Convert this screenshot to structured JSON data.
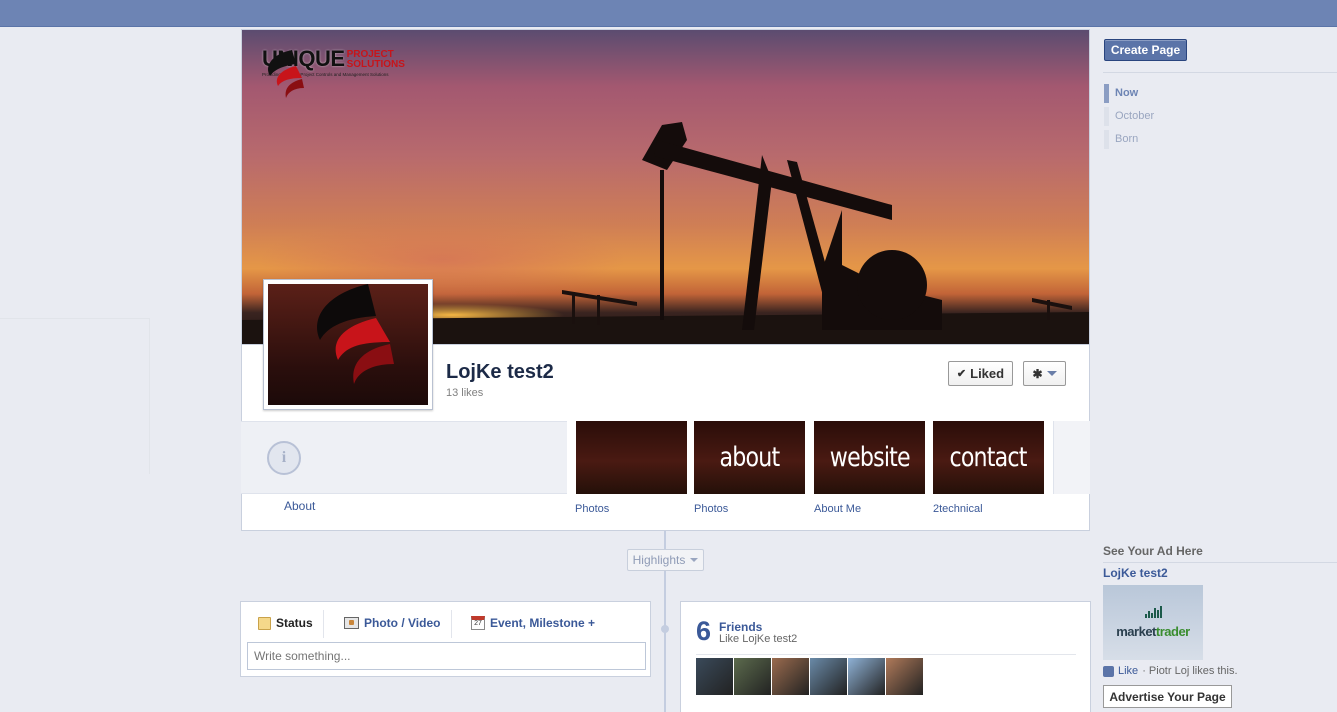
{
  "cover": {
    "brand_name": "UNIQUE",
    "brand_sub_line1": "PROJECT",
    "brand_sub_line2": "SOLUTIONS",
    "brand_tagline": "Providing Effective Project Controls and Management Solutions"
  },
  "page": {
    "name": "LojKe test2",
    "likes": "13 likes",
    "liked_label": "Liked"
  },
  "about": {
    "link": "About"
  },
  "apps": [
    {
      "tile_text": "",
      "label": "Photos"
    },
    {
      "tile_text": "about",
      "label": "Photos"
    },
    {
      "tile_text": "website",
      "label": "About Me"
    },
    {
      "tile_text": "contact",
      "label": "2technical"
    }
  ],
  "highlights": {
    "label": "Highlights"
  },
  "composer": {
    "tabs": [
      "Status",
      "Photo / Video",
      "Event, Milestone +"
    ],
    "placeholder": "Write something...",
    "event_day": "27"
  },
  "friends": {
    "count": "6",
    "title": "Friends",
    "subtitle": "Like LojKe test2",
    "thumb_colors": [
      "#3a4a5a",
      "#5c6b4d",
      "#9a6b4e",
      "#6a8aa8",
      "#8fb2d6",
      "#b07a5a"
    ]
  },
  "sidebar": {
    "create_page": "Create Page",
    "nav": [
      "Now",
      "October",
      "Born"
    ]
  },
  "ad": {
    "heading": "See Your Ad Here",
    "title": "LojKe test2",
    "image_text_a": "market",
    "image_text_b": "trader",
    "like": "Like",
    "like_text": "· Piotr Loj likes this.",
    "advertise": "Advertise Your Page"
  },
  "colors": {
    "topbar": "#6d84b4",
    "link": "#3b5998",
    "background": "#e9ebf2"
  }
}
